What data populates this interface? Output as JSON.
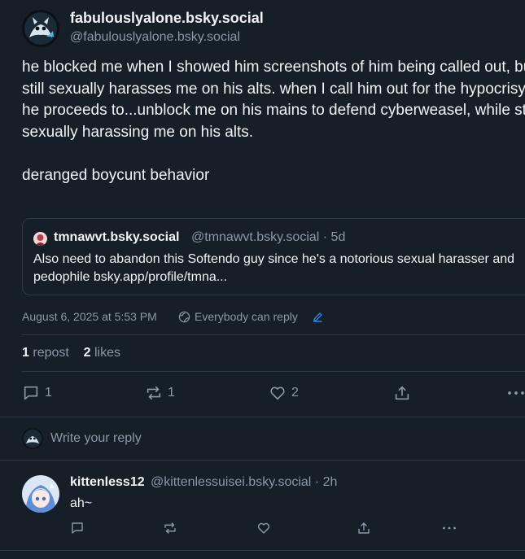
{
  "post": {
    "display_name": "fabulouslyalone.bsky.social",
    "handle": "@fabulouslyalone.bsky.social",
    "text": "he blocked me when I showed him screenshots of him being called out, but still sexually harasses me on his alts. when I call him out for the hypocrisy, he proceeds to...unblock me on his mains to defend cyberweasel, while still sexually harassing me on his alts.\n\nderanged boycunt behavior",
    "date": "August 6, 2025 at 5:53 PM",
    "reply_setting": "Everybody can reply",
    "stats": {
      "reposts_count": "1",
      "reposts_label": "repost",
      "likes_count": "2",
      "likes_label": "likes"
    },
    "actions": {
      "reply_count": "1",
      "repost_count": "1",
      "like_count": "2"
    }
  },
  "quote": {
    "display_name": "tmnawvt.bsky.social",
    "handle_time": "@tmnawvt.bsky.social · 5d",
    "text": "Also need to abandon this Softendo guy since he's a notorious sexual harasser and pedophile bsky.app/profile/tmna..."
  },
  "composer": {
    "placeholder": "Write your reply"
  },
  "reply": {
    "display_name": "kittenless12",
    "handle_time": "@kittenlessuisei.bsky.social · 2h",
    "text": "ah~"
  },
  "colors": {
    "background": "#161e27",
    "border": "#2e3a48",
    "muted_text": "#8b98a8",
    "primary_text": "#f1f3f5",
    "link_accent": "#208bfe"
  }
}
